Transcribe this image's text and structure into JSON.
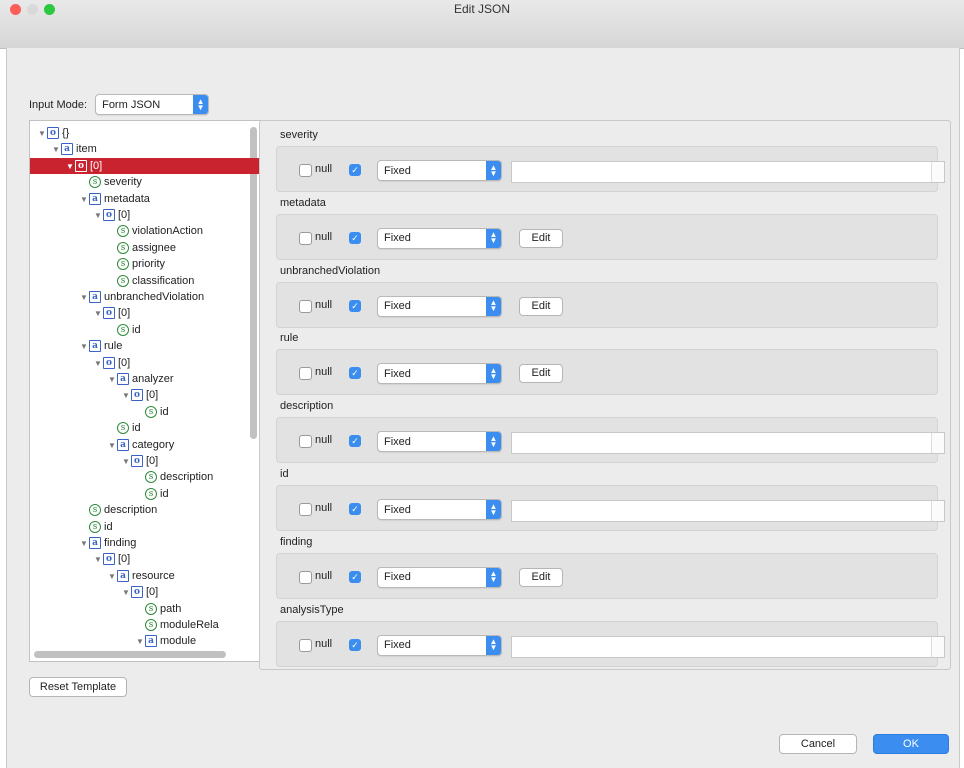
{
  "window": {
    "title": "Edit JSON"
  },
  "input_mode": {
    "label": "Input Mode:",
    "value": "Form JSON"
  },
  "tree": [
    {
      "depth": 0,
      "icon": "o",
      "label": "{}",
      "selected": false,
      "expanded": true
    },
    {
      "depth": 1,
      "icon": "a",
      "label": "item",
      "selected": false,
      "expanded": true
    },
    {
      "depth": 2,
      "icon": "o",
      "label": "[0]",
      "selected": true,
      "expanded": true
    },
    {
      "depth": 3,
      "icon": "s",
      "label": "severity",
      "selected": false
    },
    {
      "depth": 3,
      "icon": "a",
      "label": "metadata",
      "selected": false,
      "expanded": true
    },
    {
      "depth": 4,
      "icon": "o",
      "label": "[0]",
      "selected": false,
      "expanded": true
    },
    {
      "depth": 5,
      "icon": "s",
      "label": "violationAction",
      "selected": false
    },
    {
      "depth": 5,
      "icon": "s",
      "label": "assignee",
      "selected": false
    },
    {
      "depth": 5,
      "icon": "s",
      "label": "priority",
      "selected": false
    },
    {
      "depth": 5,
      "icon": "s",
      "label": "classification",
      "selected": false
    },
    {
      "depth": 3,
      "icon": "a",
      "label": "unbranchedViolation",
      "selected": false,
      "expanded": true
    },
    {
      "depth": 4,
      "icon": "o",
      "label": "[0]",
      "selected": false,
      "expanded": true
    },
    {
      "depth": 5,
      "icon": "s",
      "label": "id",
      "selected": false
    },
    {
      "depth": 3,
      "icon": "a",
      "label": "rule",
      "selected": false,
      "expanded": true
    },
    {
      "depth": 4,
      "icon": "o",
      "label": "[0]",
      "selected": false,
      "expanded": true
    },
    {
      "depth": 5,
      "icon": "a",
      "label": "analyzer",
      "selected": false,
      "expanded": true
    },
    {
      "depth": 6,
      "icon": "o",
      "label": "[0]",
      "selected": false,
      "expanded": true
    },
    {
      "depth": 7,
      "icon": "s",
      "label": "id",
      "selected": false
    },
    {
      "depth": 5,
      "icon": "s",
      "label": "id",
      "selected": false
    },
    {
      "depth": 5,
      "icon": "a",
      "label": "category",
      "selected": false,
      "expanded": true
    },
    {
      "depth": 6,
      "icon": "o",
      "label": "[0]",
      "selected": false,
      "expanded": true
    },
    {
      "depth": 7,
      "icon": "s",
      "label": "description",
      "selected": false
    },
    {
      "depth": 7,
      "icon": "s",
      "label": "id",
      "selected": false
    },
    {
      "depth": 3,
      "icon": "s",
      "label": "description",
      "selected": false
    },
    {
      "depth": 3,
      "icon": "s",
      "label": "id",
      "selected": false
    },
    {
      "depth": 3,
      "icon": "a",
      "label": "finding",
      "selected": false,
      "expanded": true
    },
    {
      "depth": 4,
      "icon": "o",
      "label": "[0]",
      "selected": false,
      "expanded": true
    },
    {
      "depth": 5,
      "icon": "a",
      "label": "resource",
      "selected": false,
      "expanded": true
    },
    {
      "depth": 6,
      "icon": "o",
      "label": "[0]",
      "selected": false,
      "expanded": true
    },
    {
      "depth": 7,
      "icon": "s",
      "label": "path",
      "selected": false
    },
    {
      "depth": 7,
      "icon": "s",
      "label": "moduleRela",
      "selected": false
    },
    {
      "depth": 7,
      "icon": "a",
      "label": "module",
      "selected": false,
      "expanded": true
    }
  ],
  "fields": [
    {
      "name": "severity",
      "null_label": "null",
      "mode": "Fixed",
      "control": "text",
      "value": ""
    },
    {
      "name": "metadata",
      "null_label": "null",
      "mode": "Fixed",
      "control": "edit",
      "edit_label": "Edit"
    },
    {
      "name": "unbranchedViolation",
      "null_label": "null",
      "mode": "Fixed",
      "control": "edit",
      "edit_label": "Edit"
    },
    {
      "name": "rule",
      "null_label": "null",
      "mode": "Fixed",
      "control": "edit",
      "edit_label": "Edit"
    },
    {
      "name": "description",
      "null_label": "null",
      "mode": "Fixed",
      "control": "text",
      "value": ""
    },
    {
      "name": "id",
      "null_label": "null",
      "mode": "Fixed",
      "control": "text",
      "value": ""
    },
    {
      "name": "finding",
      "null_label": "null",
      "mode": "Fixed",
      "control": "edit",
      "edit_label": "Edit"
    },
    {
      "name": "analysisType",
      "null_label": "null",
      "mode": "Fixed",
      "control": "text",
      "value": ""
    }
  ],
  "buttons": {
    "reset": "Reset Template",
    "cancel": "Cancel",
    "ok": "OK"
  },
  "colors": {
    "accent": "#3b8ef0",
    "selection": "#c8232f",
    "close": "#fc5f57",
    "minimize": "#d9d9d9",
    "zoom": "#2bc840"
  }
}
